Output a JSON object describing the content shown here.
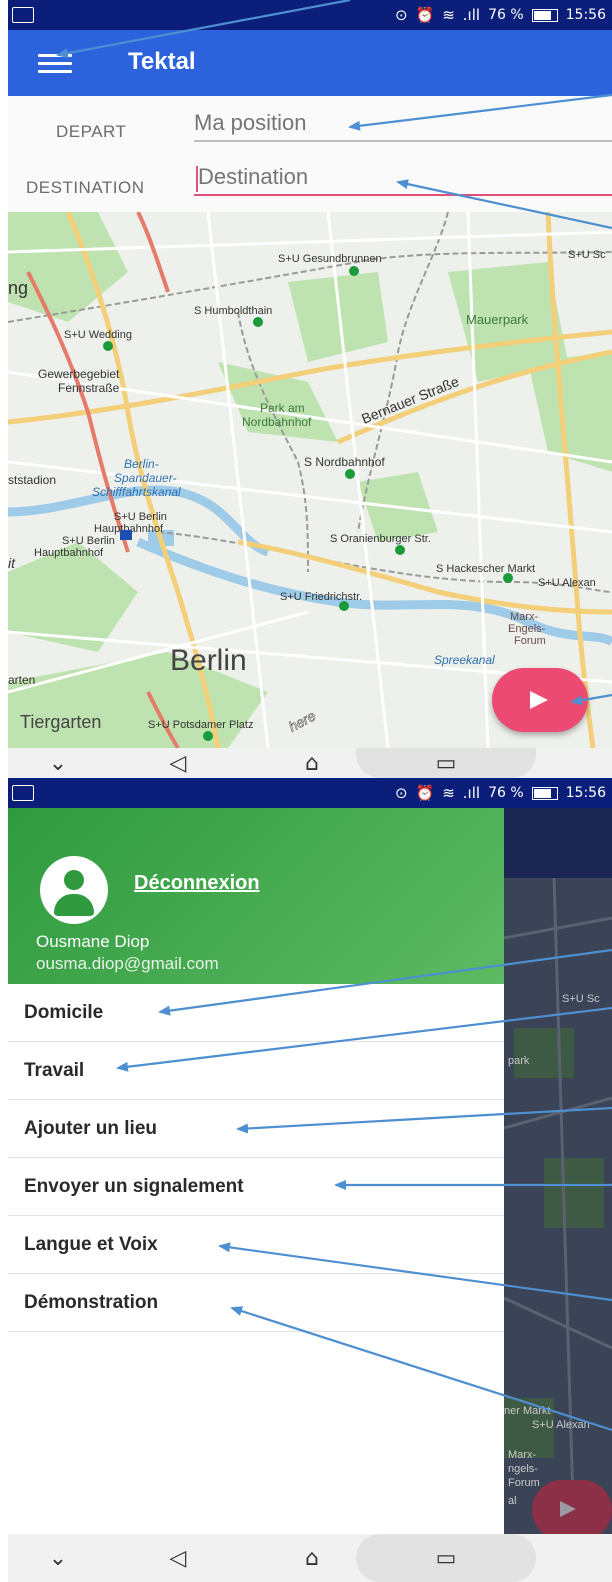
{
  "status_bar": {
    "battery": "76 %",
    "time": "15:56"
  },
  "app": {
    "title": "Tektal"
  },
  "form": {
    "depart_label": "DEPART",
    "depart_placeholder": "Ma position",
    "destination_label": "DESTINATION",
    "destination_placeholder": "Destination"
  },
  "map": {
    "labels": [
      "S+U Gesundbrunnen",
      "S+U Sc",
      "ng",
      "S Humboldthain",
      "Mauerpark",
      "S+U Wedding",
      "Gewerbegebiet",
      "Fennstraße",
      "Bernauer Straße",
      "Park am",
      "Nordbahnhof",
      "S Nordbahnhof",
      "ststadion",
      "Berlin-",
      "Spandauer-",
      "Schifffahrtskanal",
      "S+U Berlin",
      "Hauptbahnhof",
      "S+U Berlin",
      "Hauptbahnhof",
      "S Oranienburger Str.",
      "it",
      "S Hackescher Markt",
      "S+U Alexan",
      "S+U Friedrichstr.",
      "Marx-",
      "Engels-",
      "Forum",
      "Berlin",
      "Spreekanal",
      "arten",
      "Tiergarten",
      "S+U Potsdamer Platz",
      "here"
    ],
    "background_color": "#eef0ec"
  },
  "drawer": {
    "logout": "Déconnexion",
    "user_name": "Ousmane Diop",
    "user_email": "ousma.diop@gmail.com",
    "items": [
      {
        "label": "Domicile"
      },
      {
        "label": "Travail"
      },
      {
        "label": "Ajouter un lieu"
      },
      {
        "label": "Envoyer un signalement"
      },
      {
        "label": "Langue et Voix"
      },
      {
        "label": "Démonstration"
      }
    ],
    "header_color": "#2f9a3e"
  },
  "background_map_labels": [
    "S+U Sc",
    "park",
    "ner Markt",
    "S+U Alexan",
    "Marx-",
    "ngels-",
    "Forum",
    "al"
  ],
  "colors": {
    "status_bar": "#0b1f7a",
    "app_bar": "#2d62dd",
    "fab": "#ec4a73",
    "destination_underline": "#e0507a",
    "annotation_arrow": "#4d8fd0"
  }
}
